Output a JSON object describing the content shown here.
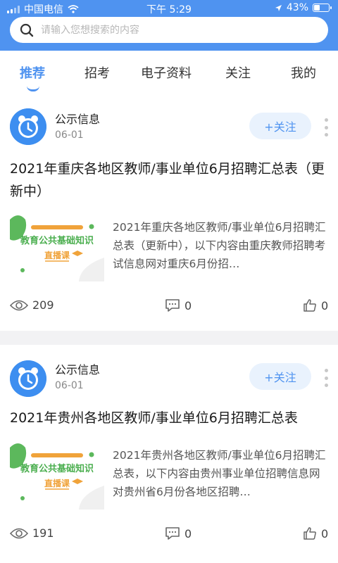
{
  "status_bar": {
    "carrier": "中国电信",
    "time": "下午 5:29",
    "battery": "43%",
    "battery_level": 0.43
  },
  "search": {
    "placeholder": "请输入您想搜索的内容"
  },
  "tabs": [
    {
      "label": "推荐",
      "active": true
    },
    {
      "label": "招考",
      "active": false
    },
    {
      "label": "电子资料",
      "active": false
    },
    {
      "label": "关注",
      "active": false
    },
    {
      "label": "我的",
      "active": false
    }
  ],
  "posts": [
    {
      "poster": "公示信息",
      "date": "06-01",
      "follow_label": "+关注",
      "title": "2021年重庆各地区教师/事业单位6月招聘汇总表（更新中）",
      "thumb_text": "教育公共基础知识",
      "thumb_badge": "直播课",
      "summary": "2021年重庆各地区教师/事业单位6月招聘汇总表（更新中），以下内容由重庆教师招聘考试信息网对重庆6月份招…",
      "views": "209",
      "comments": "0",
      "likes": "0"
    },
    {
      "poster": "公示信息",
      "date": "06-01",
      "follow_label": "+关注",
      "title": "2021年贵州各地区教师/事业单位6月招聘汇总表",
      "thumb_text": "教育公共基础知识",
      "thumb_badge": "直播课",
      "summary": "2021年贵州各地区教师/事业单位6月招聘汇总表，以下内容由贵州事业单位招聘信息网对贵州省6月份各地区招聘…",
      "views": "191",
      "comments": "0",
      "likes": "0"
    }
  ],
  "colors": {
    "accent": "#4f93f0",
    "thumb_green": "#5cb85c",
    "thumb_orange": "#f0a33a"
  }
}
